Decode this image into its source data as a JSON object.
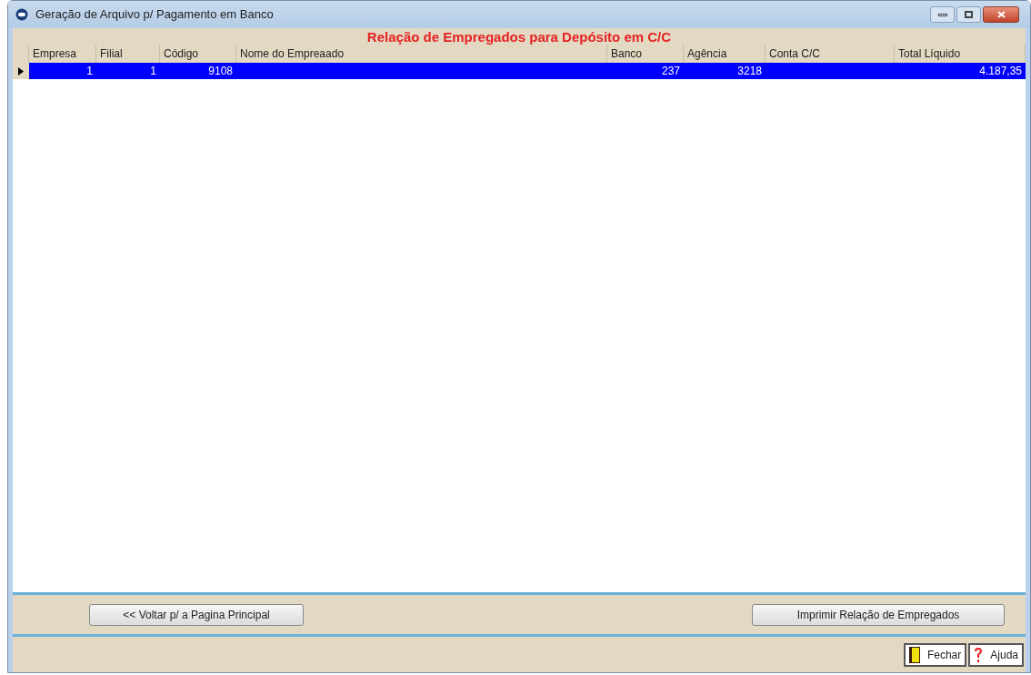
{
  "window": {
    "title": "Geração de Arquivo p/ Pagamento em Banco"
  },
  "heading": "Relação de Empregados para Depósito em C/C",
  "table": {
    "columns": [
      "Empresa",
      "Filial",
      "Código",
      "Nome do Empreaado",
      "Banco",
      "Agência",
      "Conta C/C",
      "Total Líquido"
    ],
    "rows": [
      {
        "selected": true,
        "cells": [
          "1",
          "1",
          "9108",
          "",
          "237",
          "3218",
          "",
          "4.187,35"
        ]
      }
    ]
  },
  "buttons": [
    "<< Voltar p/ a Pagina Principal",
    "Imprimir Relação de Empregados"
  ],
  "footer_buttons": [
    {
      "kind": "close",
      "label": "Fechar"
    },
    {
      "kind": "help",
      "label": "Ajuda"
    }
  ]
}
